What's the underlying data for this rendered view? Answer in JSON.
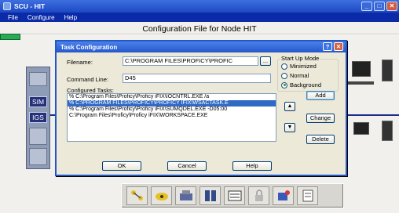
{
  "app": {
    "title": "SCU - HIT",
    "menu": [
      "File",
      "Configure",
      "Help"
    ],
    "heading": "Configuration File for Node HIT"
  },
  "device": {
    "labels": [
      "SIM",
      "IGS"
    ]
  },
  "dialog": {
    "title": "Task Configuration",
    "filename_label": "Filename:",
    "filename_value": "C:\\PROGRAM FILES\\PROFICY\\PROFIC",
    "browse_label": "...",
    "command_label": "Command Line:",
    "command_value": "D45",
    "startup_mode_label": "Start Up Mode",
    "startup_modes": [
      {
        "label": "Minimized",
        "selected": false
      },
      {
        "label": "Normal",
        "selected": false
      },
      {
        "label": "Background",
        "selected": true
      }
    ],
    "configured_label": "Configured Tasks:",
    "tasks": [
      {
        "text": "% C:\\Program Files\\Proficy\\Proficy iFIX\\IOCNTRL.EXE  /a",
        "selected": false
      },
      {
        "text": "% C:\\PROGRAM FILES\\PROFICY\\PROFICY IFIX\\WSACTASK.E",
        "selected": true
      },
      {
        "text": "% C:\\Program Files\\Proficy\\Proficy iFIX\\SUMQDEL.EXE  -D05:00",
        "selected": false
      },
      {
        "text": "  C:\\Program Files\\Proficy\\Proficy iFIX\\WORKSPACE.EXE",
        "selected": false
      }
    ],
    "buttons": {
      "add": "Add",
      "change": "Change",
      "delete": "Delete",
      "ok": "OK",
      "cancel": "Cancel",
      "help": "Help",
      "up": "▲",
      "down": "▼",
      "help_tb": "?",
      "close_tb": "✕"
    }
  },
  "toolbar": {
    "icons": [
      "network-icon",
      "alarm-icon",
      "sql-icon",
      "database-icon",
      "scada-icon",
      "security-icon",
      "task-icon",
      "config-icon"
    ]
  }
}
